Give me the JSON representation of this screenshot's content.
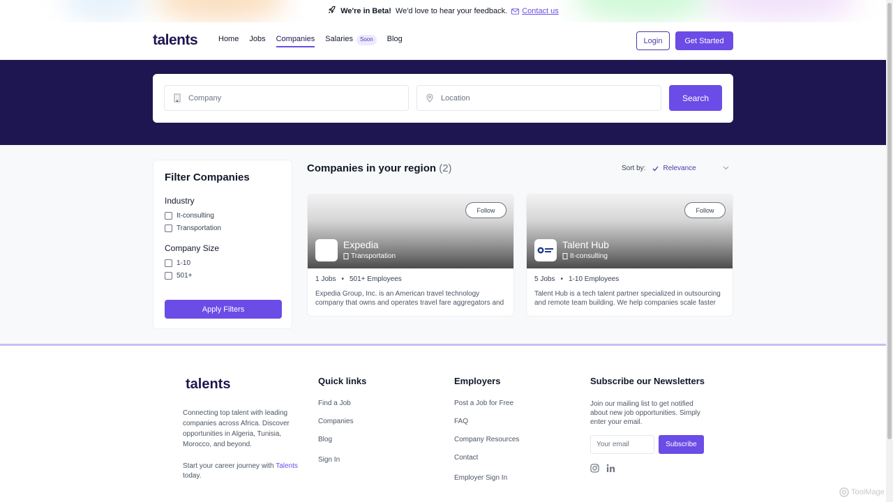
{
  "banner": {
    "beta_title": "We're in Beta!",
    "beta_text": "We'd love to hear your feedback.",
    "contact_label": "Contact us"
  },
  "nav": {
    "logo": "talents",
    "items": [
      {
        "label": "Home"
      },
      {
        "label": "Jobs"
      },
      {
        "label": "Companies"
      },
      {
        "label": "Salaries",
        "badge": "Soon"
      },
      {
        "label": "Blog"
      }
    ],
    "active": "Companies",
    "login_label": "Login",
    "get_started_label": "Get Started"
  },
  "search": {
    "company_placeholder": "Company",
    "location_placeholder": "Location",
    "button_label": "Search"
  },
  "filter": {
    "title": "Filter Companies",
    "industry_label": "Industry",
    "industries": [
      "It-consulting",
      "Transportation"
    ],
    "size_label": "Company Size",
    "sizes": [
      "1-10",
      "501+"
    ],
    "apply_label": "Apply Filters"
  },
  "results": {
    "title": "Companies in your region",
    "count": "(2)",
    "sort_label": "Sort by:",
    "sort_value": "Relevance"
  },
  "companies": [
    {
      "name": "Expedia",
      "industry": "Transportation",
      "jobs": "1 Jobs",
      "employees": "501+ Employees",
      "description": "Expedia Group, Inc. is an American travel technology company that owns and operates travel fare aggregators and travel metasearch engines.",
      "follow_label": "Follow"
    },
    {
      "name": "Talent Hub",
      "industry": "It-consulting",
      "jobs": "5 Jobs",
      "employees": "1-10 Employees",
      "description": "Talent Hub is a tech talent partner specialized in outsourcing and remote team building. We help companies scale faster with vetted engineers.",
      "follow_label": "Follow"
    }
  ],
  "footer": {
    "logo": "talents",
    "about": "Connecting top talent with leading companies across Africa. Discover opportunities in Algeria, Tunisia, Morocco, and beyond.",
    "journey_prefix": "Start your career journey with",
    "journey_brand": "Talents",
    "journey_suffix": "today.",
    "quick_links_title": "Quick links",
    "quick_links": [
      "Find a Job",
      "Companies",
      "Blog",
      "Sign In"
    ],
    "employers_title": "Employers",
    "employers": [
      "Post a Job for Free",
      "FAQ",
      "Company Resources",
      "Contact",
      "Employer Sign In"
    ],
    "newsletter_title": "Subscribe our Newsletters",
    "newsletter_text": "Join our mailing list to get notified about new job opportunities. Simply enter your email.",
    "email_placeholder": "Your email",
    "subscribe_label": "Subscribe"
  },
  "watermark": "ToolMage",
  "colors": {
    "accent": "#6b4ce6",
    "hero": "#1e1650"
  }
}
